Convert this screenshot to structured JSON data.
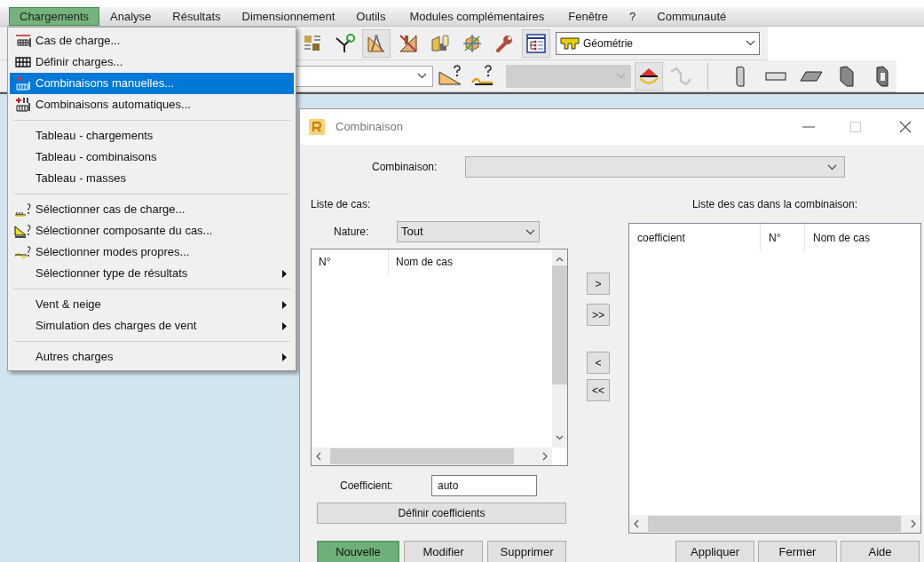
{
  "menubar": [
    {
      "label": "Chargements",
      "selected": true
    },
    {
      "label": "Analyse",
      "selected": false
    },
    {
      "label": "Résultats",
      "selected": false
    },
    {
      "label": "Dimensionnement",
      "selected": false
    },
    {
      "label": "Outils",
      "selected": false
    },
    {
      "label": "Modules complémentaires",
      "selected": false
    },
    {
      "label": "Fenêtre",
      "selected": false
    },
    {
      "label": "?",
      "selected": false
    },
    {
      "label": "Communauté",
      "selected": false
    }
  ],
  "toolbar_top": {
    "tools": [
      {
        "pressed": false
      },
      {
        "pressed": false
      },
      {
        "pressed": true
      },
      {
        "pressed": false
      },
      {
        "pressed": false
      },
      {
        "pressed": false
      },
      {
        "pressed": false
      },
      {
        "pressed": true
      }
    ],
    "view_select": {
      "value": "Géométrie"
    }
  },
  "toolbar_bottom": {
    "tools": [
      {
        "pressed": false,
        "disabled": false
      },
      {
        "pressed": false,
        "disabled": false
      },
      {
        "pressed": true,
        "disabled": false
      },
      {
        "pressed": false,
        "disabled": true
      }
    ],
    "shapes": [
      {
        "pressed": false
      },
      {
        "pressed": false
      },
      {
        "pressed": false
      },
      {
        "pressed": false
      },
      {
        "pressed": false
      }
    ]
  },
  "menu": {
    "items": [
      {
        "kind": "item",
        "label": "Cas de charge...",
        "has_icon": true,
        "highlighted": false,
        "submenu": false
      },
      {
        "kind": "item",
        "label": "Définir charges...",
        "has_icon": true,
        "highlighted": false,
        "submenu": false
      },
      {
        "kind": "item",
        "label": "Combinaisons manuelles...",
        "has_icon": true,
        "highlighted": true,
        "submenu": false
      },
      {
        "kind": "item",
        "label": "Combinaisons automatiques...",
        "has_icon": true,
        "highlighted": false,
        "submenu": false
      },
      {
        "kind": "separator"
      },
      {
        "kind": "item",
        "label": "Tableau - chargements",
        "has_icon": false,
        "highlighted": false,
        "submenu": false
      },
      {
        "kind": "item",
        "label": "Tableau - combinaisons",
        "has_icon": false,
        "highlighted": false,
        "submenu": false
      },
      {
        "kind": "item",
        "label": "Tableau - masses",
        "has_icon": false,
        "highlighted": false,
        "submenu": false
      },
      {
        "kind": "separator"
      },
      {
        "kind": "item",
        "label": "Sélectionner cas de charge...",
        "has_icon": true,
        "highlighted": false,
        "submenu": false
      },
      {
        "kind": "item",
        "label": "Sélectionner composante du cas...",
        "has_icon": true,
        "highlighted": false,
        "submenu": false
      },
      {
        "kind": "item",
        "label": "Sélectionner modes propres...",
        "has_icon": true,
        "highlighted": false,
        "submenu": false
      },
      {
        "kind": "item",
        "label": "Sélectionner type de résultats",
        "has_icon": false,
        "highlighted": false,
        "submenu": true
      },
      {
        "kind": "separator"
      },
      {
        "kind": "item",
        "label": "Vent & neige",
        "has_icon": false,
        "highlighted": false,
        "submenu": true
      },
      {
        "kind": "item",
        "label": "Simulation des charges de vent",
        "has_icon": false,
        "highlighted": false,
        "submenu": true
      },
      {
        "kind": "separator"
      },
      {
        "kind": "item",
        "label": "Autres charges",
        "has_icon": false,
        "highlighted": false,
        "submenu": true
      }
    ]
  },
  "dialog": {
    "title": "Combinaison",
    "combinaison_label": "Combinaison:",
    "case_list_label": "Liste de cas:",
    "nature_label": "Nature:",
    "nature_value": "Tout",
    "case_table": {
      "columns": [
        "N°",
        "Nom de cas"
      ]
    },
    "transfer_buttons": [
      ">",
      ">>",
      "<",
      "<<"
    ],
    "coefficient_label": "Coefficient:",
    "coefficient_value": "auto",
    "define_button": "Définir coefficients",
    "combination_list_label": "Liste des cas dans la combinaison:",
    "combination_table": {
      "columns": [
        "coefficient",
        "N°",
        "Nom de cas"
      ]
    },
    "left_buttons": [
      {
        "label": "Nouvelle",
        "selected": true
      },
      {
        "label": "Modifier",
        "selected": false
      },
      {
        "label": "Supprimer",
        "selected": false
      }
    ],
    "right_buttons": [
      {
        "label": "Appliquer",
        "selected": false
      },
      {
        "label": "Fermer",
        "selected": false
      },
      {
        "label": "Aide",
        "selected": false
      }
    ]
  }
}
